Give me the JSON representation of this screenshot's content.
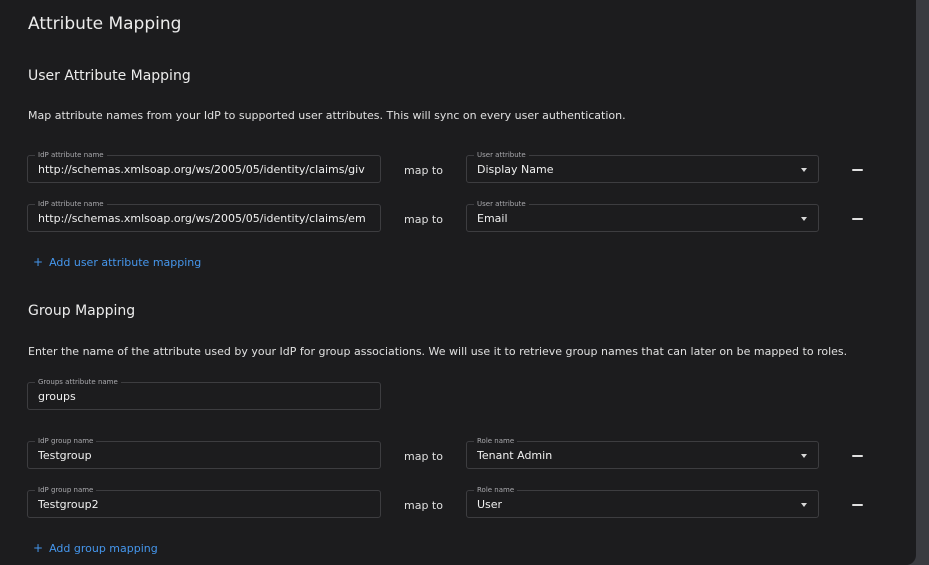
{
  "title": "Attribute Mapping",
  "user_section": {
    "heading": "User Attribute Mapping",
    "description": "Map attribute names from your IdP to supported user attributes. This will sync on every user authentication.",
    "rows": [
      {
        "idp_label": "IdP attribute name",
        "idp_value": "http://schemas.xmlsoap.org/ws/2005/05/identity/claims/giv",
        "map_to": "map to",
        "select_label": "User attribute",
        "select_value": "Display Name"
      },
      {
        "idp_label": "IdP attribute name",
        "idp_value": "http://schemas.xmlsoap.org/ws/2005/05/identity/claims/em",
        "map_to": "map to",
        "select_label": "User attribute",
        "select_value": "Email"
      }
    ],
    "add_label": "Add user attribute mapping"
  },
  "group_section": {
    "heading": "Group Mapping",
    "description": "Enter the name of the attribute used by your IdP for group associations. We will use it to retrieve group names that can later on be mapped to roles.",
    "groups_attr_label": "Groups attribute name",
    "groups_attr_value": "groups",
    "rows": [
      {
        "idp_label": "IdP group name",
        "idp_value": "Testgroup",
        "map_to": "map to",
        "select_label": "Role name",
        "select_value": "Tenant Admin"
      },
      {
        "idp_label": "IdP group name",
        "idp_value": "Testgroup2",
        "map_to": "map to",
        "select_label": "Role name",
        "select_value": "User"
      }
    ],
    "add_label": "Add group mapping"
  },
  "icons": {
    "plus": "+",
    "remove": "minus-icon",
    "dropdown": "caret-down-icon"
  },
  "colors": {
    "background": "#1c1c1e",
    "link": "#4596ec",
    "border": "#3d3d40"
  }
}
